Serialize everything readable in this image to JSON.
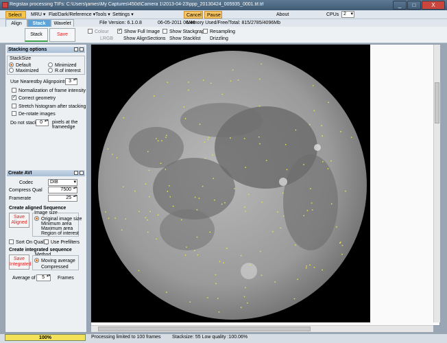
{
  "window": {
    "title": "Registax processing TIFs: C:\\Users\\james\\My Captures\\450d\\Camera 1\\2013-04-23\\ppp_20130424_005935_0001.tif.tif",
    "minimize": "_",
    "maximize": "□",
    "close": "X"
  },
  "menu": {
    "select": "Select",
    "mru": "MRU ▾",
    "flat": "Flat/Dark/Reference ▾",
    "tools": "Tools ▾",
    "settings": "Settings ▾",
    "cancel": "Cancel",
    "pause": "Pause",
    "about": "About",
    "cpus_label": "CPUs",
    "cpus_value": "2"
  },
  "tabs": {
    "align": "Align",
    "stack": "Stack",
    "wavelet": "Wavelet",
    "file_version": "File Version: 6.1.0.8",
    "date": "06-05-2011 06:46",
    "memory": "Memory Used/Free/Total: 815/2785/4096Mb"
  },
  "toolbar": {
    "stack": "Stack",
    "save_image": "Save image",
    "colour": "Colour",
    "lrgb": "LRGB",
    "show_full_image": "Show Full Image",
    "show_alignsections": "Show AlignSections",
    "show_stackgraph": "Show Stackgraph",
    "show_stacklist": "Show Stacklist",
    "resampling": "Resampling",
    "drizzling": "Drizzling"
  },
  "stacking": {
    "title": "Stacking options",
    "stacksize": "StackSize",
    "default": "Default",
    "minimized": "Minimized",
    "maximized": "Maximized",
    "roi": "R.of interest",
    "use_nearest": "Use Nearestby Alignpoints",
    "nearest_value": "3",
    "normalization": "Normalization of frame intensity",
    "correct_geometry": "Correct geometry",
    "stretch": "Stretch histogram after stacking",
    "derotate": "De-rotate images",
    "do_not_stack": "Do not stack",
    "do_not_stack_value": "0",
    "pixels_at": "pixels at the",
    "frameedge": "frameedge"
  },
  "avi": {
    "title": "Create AVI",
    "codec_label": "Codec",
    "codec_value": "DIB",
    "compress_label": "Compress Qual",
    "compress_value": "7500",
    "framerate_label": "Framerate",
    "framerate_value": "25",
    "aligned_title": "Create aligned Sequence",
    "save_aligned": "Save Aligned",
    "image_size": "Image size",
    "original": "Original image size",
    "minimum": "Minimum area",
    "maximum": "Maximum area",
    "region": "Region of interest",
    "sort_quality": "Sort On Quality",
    "use_prefilters": "Use Prefilters",
    "integrated_title": "Create integrated sequence",
    "save_integrated": "Save Integrated",
    "method": "Method",
    "moving_average": "Moving average",
    "compressed": "Compressed",
    "average_of": "Average of",
    "average_value": "5",
    "frames": "Frames"
  },
  "status": {
    "progress_text": "100%",
    "progress_fraction": 1.0,
    "processing": "Processing limited to 100 frames",
    "stacksize": "Stacksize: 55 Low quality :100.06%"
  },
  "colors": {
    "accent_yellow": "#f5c64a",
    "tab_blue": "#5fa3d6",
    "red_text": "#e02020",
    "progress": "#f3e15a"
  }
}
